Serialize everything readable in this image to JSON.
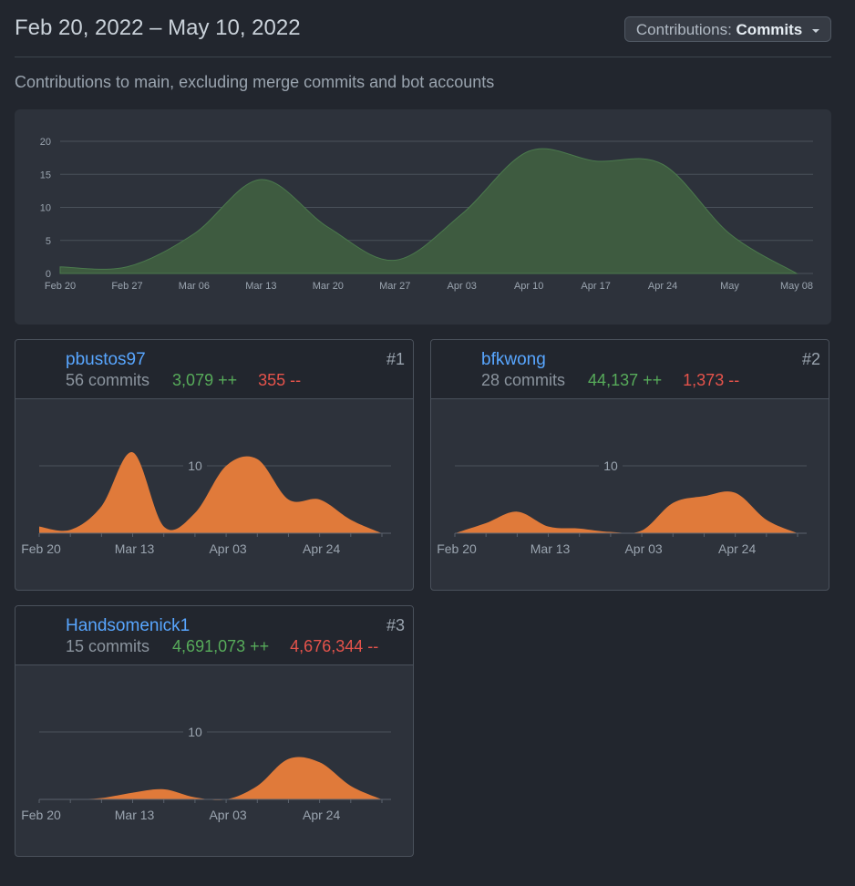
{
  "header": {
    "date_range": "Feb 20, 2022 – May 10, 2022",
    "dropdown_prefix": "Contributions:",
    "dropdown_value": "Commits"
  },
  "subtitle": "Contributions to main, excluding merge commits and bot accounts",
  "colors": {
    "overview_fill": "#3e5b40",
    "overview_line": "#4b7a4d",
    "contrib_fill": "#e07a3a",
    "username": "#58a6ff",
    "additions": "#57ab5a",
    "deletions": "#e5534b"
  },
  "contributors": [
    {
      "username": "pbustos97",
      "rank": "#1",
      "commits": "56 commits",
      "additions": "3,079 ++",
      "deletions": "355 --",
      "avatar_icon": "dog-avatar-icon"
    },
    {
      "username": "bfkwong",
      "rank": "#2",
      "commits": "28 commits",
      "additions": "44,137 ++",
      "deletions": "1,373 --",
      "avatar_icon": "cartoon-avatar-icon"
    },
    {
      "username": "Handsomenick1",
      "rank": "#3",
      "commits": "15 commits",
      "additions": "4,691,073 ++",
      "deletions": "4,676,344 --",
      "avatar_icon": "dragon-avatar-icon"
    }
  ],
  "chart_data": [
    {
      "type": "area",
      "title": "",
      "x": [
        "Feb 20",
        "Feb 27",
        "Mar 06",
        "Mar 13",
        "Mar 20",
        "Mar 27",
        "Apr 03",
        "Apr 10",
        "Apr 17",
        "Apr 24",
        "May",
        "May 08"
      ],
      "tick_labels": [
        "Feb 20",
        "Feb 27",
        "Mar 06",
        "Mar 13",
        "Mar 20",
        "Mar 27",
        "Apr 03",
        "Apr 10",
        "Apr 17",
        "Apr 24",
        "May",
        "May 08"
      ],
      "values": [
        1,
        1,
        6,
        14.2,
        7,
        2,
        9,
        18.5,
        17,
        16.5,
        6,
        0
      ],
      "ylim": [
        0,
        20
      ],
      "yticks": [
        "0",
        "5",
        "10",
        "15",
        "20"
      ],
      "grid": true
    },
    {
      "type": "area",
      "contributor": "pbustos97",
      "x": [
        "Feb 20",
        "Feb 27",
        "Mar 06",
        "Mar 13",
        "Mar 20",
        "Mar 27",
        "Apr 03",
        "Apr 10",
        "Apr 17",
        "Apr 24",
        "May",
        "May 08"
      ],
      "tick_labels": [
        "Feb 20",
        "Mar 13",
        "Apr 03",
        "Apr 24"
      ],
      "values": [
        1,
        0.5,
        4,
        12,
        1,
        3,
        10,
        11,
        5,
        5,
        2,
        0
      ],
      "ylim": [
        0,
        20
      ],
      "yticks": [
        "10"
      ]
    },
    {
      "type": "area",
      "contributor": "bfkwong",
      "x": [
        "Feb 20",
        "Feb 27",
        "Mar 06",
        "Mar 13",
        "Mar 20",
        "Mar 27",
        "Apr 03",
        "Apr 10",
        "Apr 17",
        "Apr 24",
        "May",
        "May 08"
      ],
      "tick_labels": [
        "Feb 20",
        "Mar 13",
        "Apr 03",
        "Apr 24"
      ],
      "values": [
        0,
        1.5,
        3.2,
        1,
        0.7,
        0.2,
        0.4,
        4.5,
        5.5,
        6,
        2,
        0
      ],
      "ylim": [
        0,
        20
      ],
      "yticks": [
        "10"
      ]
    },
    {
      "type": "area",
      "contributor": "Handsomenick1",
      "x": [
        "Feb 20",
        "Feb 27",
        "Mar 06",
        "Mar 13",
        "Mar 20",
        "Mar 27",
        "Apr 03",
        "Apr 10",
        "Apr 17",
        "Apr 24",
        "May",
        "May 08"
      ],
      "tick_labels": [
        "Feb 20",
        "Mar 13",
        "Apr 03",
        "Apr 24"
      ],
      "values": [
        0,
        0,
        0.2,
        1,
        1.5,
        0.3,
        0,
        2,
        6,
        5.5,
        2,
        0
      ],
      "ylim": [
        0,
        20
      ],
      "yticks": [
        "10"
      ]
    }
  ]
}
